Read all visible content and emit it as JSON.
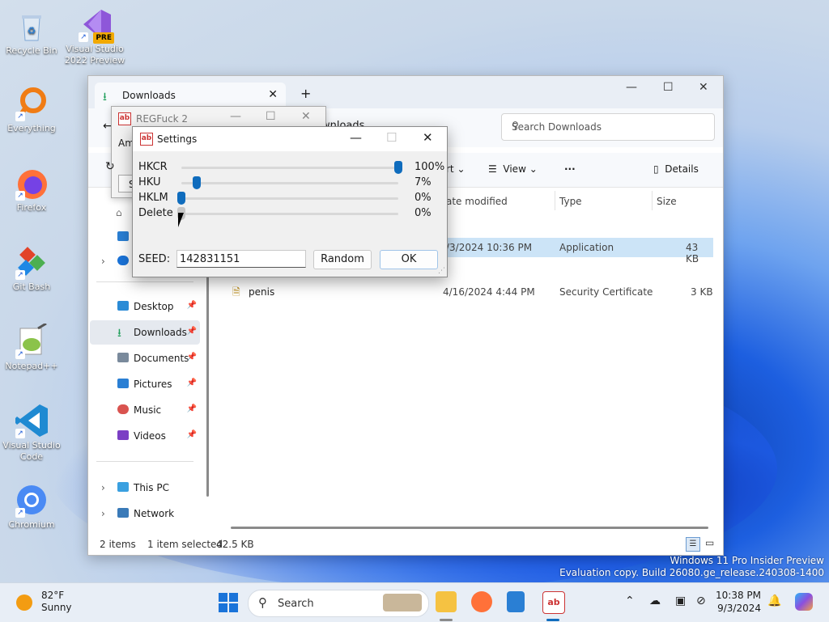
{
  "desktop": {
    "icons": [
      {
        "label": "Recycle Bin"
      },
      {
        "label": "Visual Studio 2022 Preview",
        "badge": "PRE"
      },
      {
        "label": "Everything"
      },
      {
        "label": "Firefox"
      },
      {
        "label": "Git Bash"
      },
      {
        "label": "Notepad++"
      },
      {
        "label": "Visual Studio Code"
      },
      {
        "label": "Chromium"
      }
    ],
    "watermark": {
      "line1": "Windows 11 Pro Insider Preview",
      "line2": "Evaluation copy. Build 26080.ge_release.240308-1400"
    }
  },
  "explorer": {
    "tab_title": "Downloads",
    "new_tab": "+",
    "breadcrumb_partial": "wnloads",
    "search_placeholder": "Search Downloads",
    "commands": {
      "sort_partial": "rt",
      "view": "View",
      "more": "···",
      "details": "Details"
    },
    "columns": {
      "date_partial": "ate modified",
      "type": "Type",
      "size": "Size"
    },
    "files": [
      {
        "name": "",
        "date_partial": "/3/2024 10:36 PM",
        "type": "Application",
        "size": "43 KB",
        "selected": true
      },
      {
        "name": "penis",
        "date": "4/16/2024 4:44 PM",
        "type": "Security Certificate",
        "size": "3 KB",
        "selected": false
      }
    ],
    "nav": {
      "pinned": [
        {
          "label": "Desktop",
          "color": "#2a8bd6"
        },
        {
          "label": "Downloads",
          "color": "#1f9e5a"
        },
        {
          "label": "Documents",
          "color": "#7a8a9c"
        },
        {
          "label": "Pictures",
          "color": "#2a7fd4"
        },
        {
          "label": "Music",
          "color": "#d9534f"
        },
        {
          "label": "Videos",
          "color": "#7b3fc4"
        }
      ],
      "this_pc": "This PC",
      "network": "Network"
    },
    "status": {
      "items": "2 items",
      "selected": "1 item selected",
      "size": "42.5 KB"
    }
  },
  "regfuck": {
    "title": "REGFuck 2",
    "partial_label": "Amc",
    "partial_btn": "S"
  },
  "settings": {
    "title": "Settings",
    "sliders": [
      {
        "label": "HKCR",
        "percent": "100%",
        "value": 1.0,
        "enabled": true
      },
      {
        "label": "HKU",
        "percent": "7%",
        "value": 0.07,
        "enabled": true
      },
      {
        "label": "HKLM",
        "percent": "0%",
        "value": 0.0,
        "enabled": true
      },
      {
        "label": "Delete",
        "percent": "0%",
        "value": 0.0,
        "enabled": false
      }
    ],
    "seed_label": "SEED:",
    "seed_value": "142831151",
    "random_button": "Random",
    "ok_button": "OK"
  },
  "taskbar": {
    "weather_temp": "82°F",
    "weather_desc": "Sunny",
    "search_placeholder": "Search",
    "time": "10:38 PM",
    "date": "9/3/2024"
  },
  "colors": {
    "accent": "#0f6cbd",
    "selection": "#cce4f7"
  }
}
